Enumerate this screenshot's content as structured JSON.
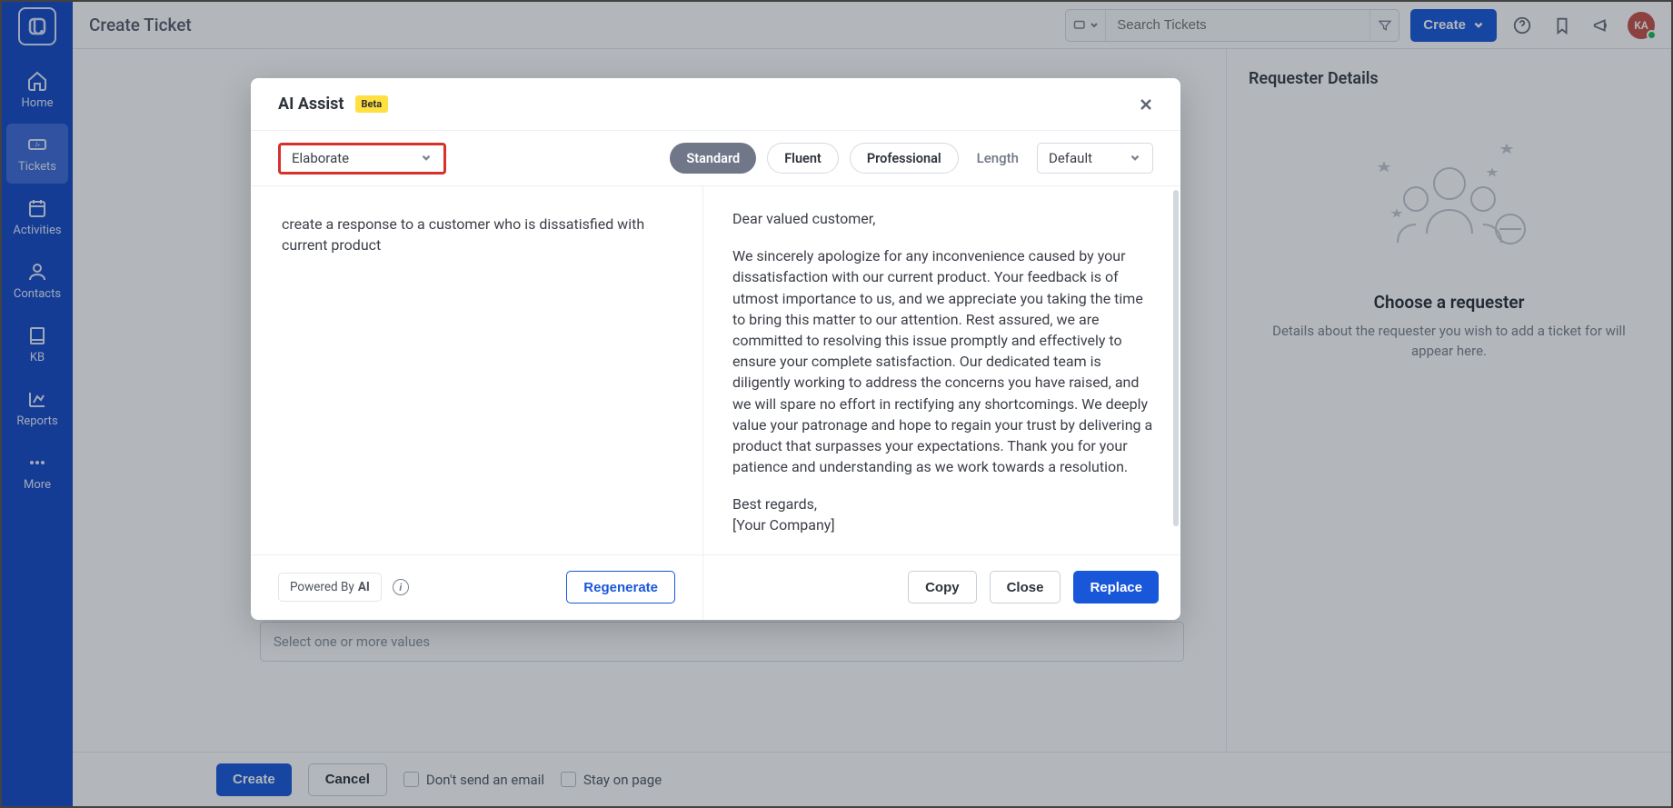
{
  "header": {
    "title": "Create Ticket",
    "search_placeholder": "Search Tickets",
    "create_btn": "Create",
    "avatar_initials": "KA"
  },
  "sidebar": {
    "items": [
      {
        "label": "Home"
      },
      {
        "label": "Tickets"
      },
      {
        "label": "Activities"
      },
      {
        "label": "Contacts"
      },
      {
        "label": "KB"
      },
      {
        "label": "Reports"
      },
      {
        "label": "More"
      }
    ]
  },
  "form": {
    "multiselect_placeholder": "Select one or more values"
  },
  "footer": {
    "create": "Create",
    "cancel": "Cancel",
    "dont_send": "Don't send an email",
    "stay": "Stay on page"
  },
  "right_panel": {
    "title": "Requester Details",
    "placeholder_title": "Choose a requester",
    "placeholder_desc": "Details about the requester you wish to add a ticket for will appear here."
  },
  "modal": {
    "title": "AI Assist",
    "badge": "Beta",
    "mode_selected": "Elaborate",
    "tones": [
      "Standard",
      "Fluent",
      "Professional"
    ],
    "length_label": "Length",
    "length_selected": "Default",
    "prompt": "create a response to a customer who is dissatisfied with current product",
    "response": {
      "greeting": "Dear valued customer,",
      "body": "We sincerely apologize for any inconvenience caused by your dissatisfaction with our current product. Your feedback is of utmost importance to us, and we appreciate you taking the time to bring this matter to our attention. Rest assured, we are committed to resolving this issue promptly and effectively to ensure your complete satisfaction. Our dedicated team is diligently working to address the concerns you have raised, and we will spare no effort in rectifying any shortcomings. We deeply value your patronage and hope to regain your trust by delivering a product that surpasses your expectations. Thank you for your patience and understanding as we work towards a resolution.",
      "signoff": "Best regards,",
      "company": "[Your Company]"
    },
    "powered_prefix": "Powered By",
    "powered_suffix": "AI",
    "actions": {
      "regenerate": "Regenerate",
      "copy": "Copy",
      "close": "Close",
      "replace": "Replace"
    }
  }
}
